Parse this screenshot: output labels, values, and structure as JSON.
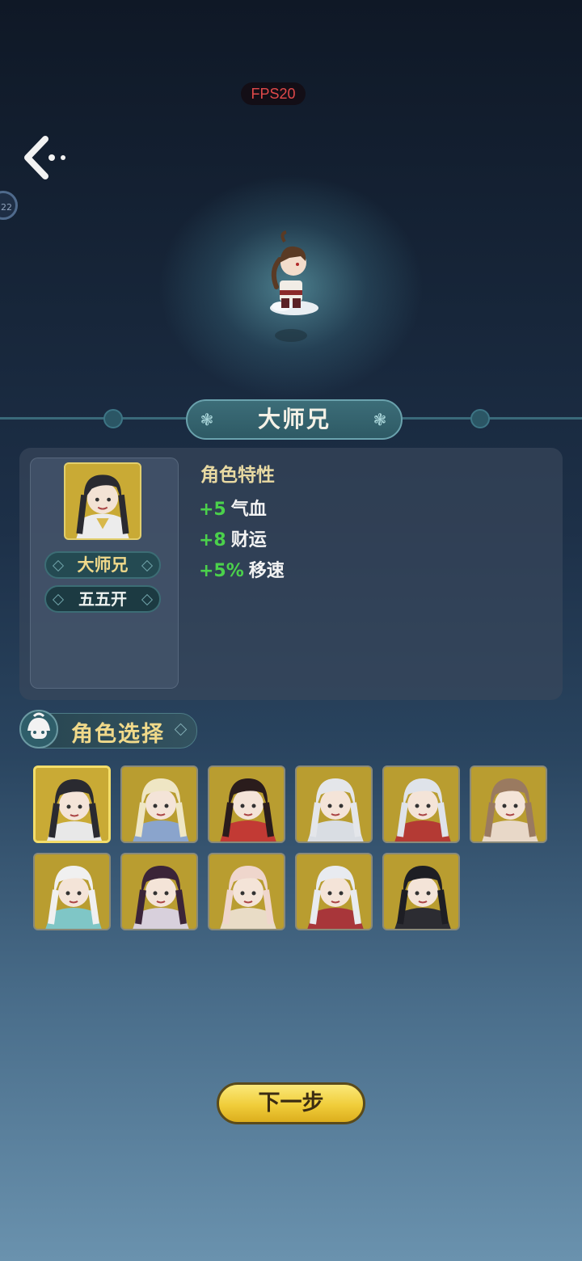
{
  "hud": {
    "fps_label": "FPS20",
    "side_badge": "22"
  },
  "character": {
    "name": "大师兄",
    "tag": "五五开",
    "traits_title": "角色特性",
    "traits": [
      {
        "value": "+5",
        "label": "气血"
      },
      {
        "value": "+8",
        "label": "财运"
      },
      {
        "value": "+5%",
        "label": "移速"
      }
    ]
  },
  "selection": {
    "title": "角色选择",
    "selected_index": 0,
    "characters": [
      {
        "icon": "character-portrait-icon",
        "hair": "#2a2a30",
        "bg": "#c9aa35",
        "outfit": "#e8e8e8"
      },
      {
        "icon": "character-portrait-icon",
        "hair": "#efe6c4",
        "bg": "#b99d30",
        "outfit": "#8aa4cc"
      },
      {
        "icon": "character-portrait-icon",
        "hair": "#2a1c1c",
        "bg": "#b99d30",
        "outfit": "#c23a34"
      },
      {
        "icon": "character-portrait-icon",
        "hair": "#e4e6ea",
        "bg": "#b99d30",
        "outfit": "#d9dde3"
      },
      {
        "icon": "character-portrait-icon",
        "hair": "#dfe3ea",
        "bg": "#b99d30",
        "outfit": "#b43a34"
      },
      {
        "icon": "character-portrait-icon",
        "hair": "#9a7a60",
        "bg": "#b99d30",
        "outfit": "#e8d8c8"
      },
      {
        "icon": "character-portrait-icon",
        "hair": "#f0f0f0",
        "bg": "#b99d30",
        "outfit": "#7fc6c6"
      },
      {
        "icon": "character-portrait-icon",
        "hair": "#3b2438",
        "bg": "#b99d30",
        "outfit": "#d8d0dc"
      },
      {
        "icon": "character-portrait-icon",
        "hair": "#efd6cc",
        "bg": "#b99d30",
        "outfit": "#e9dcc6"
      },
      {
        "icon": "character-portrait-icon",
        "hair": "#e8ebf0",
        "bg": "#b99d30",
        "outfit": "#a8363a"
      },
      {
        "icon": "character-portrait-icon",
        "hair": "#1e1e24",
        "bg": "#b99d30",
        "outfit": "#2c2c32"
      }
    ]
  },
  "actions": {
    "next_label": "下一步"
  },
  "colors": {
    "accent": "#f0cd3a",
    "trait_value": "#4bd14b",
    "trait_title": "#e8d9a2"
  }
}
